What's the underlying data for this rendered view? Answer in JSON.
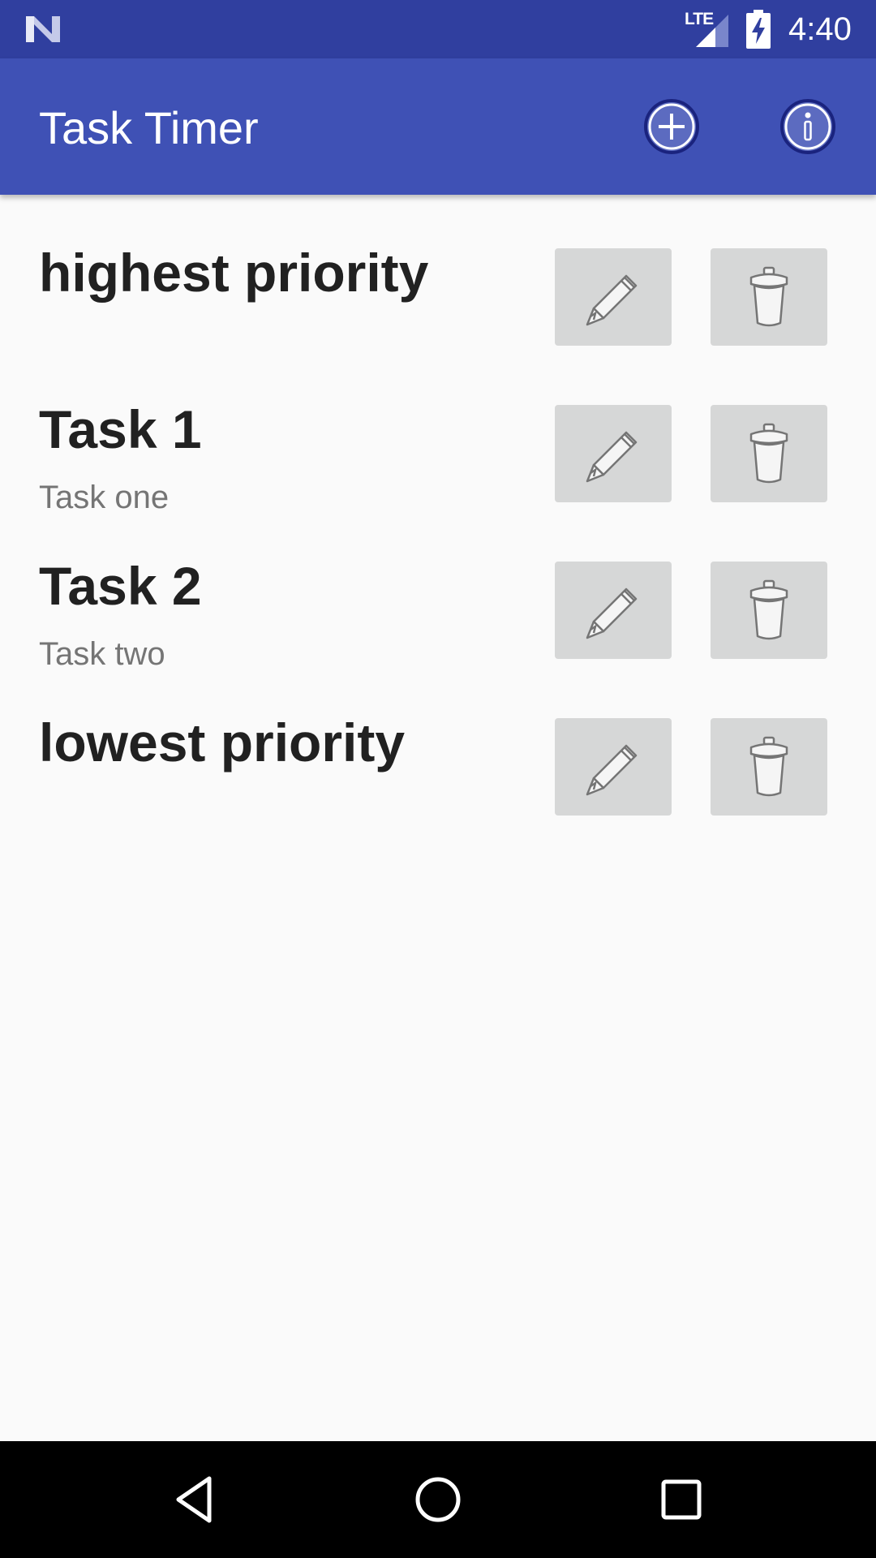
{
  "status_bar": {
    "network_label": "LTE",
    "time": "4:40",
    "icons": [
      "notification-n-icon",
      "signal-icon",
      "battery-charging-icon"
    ]
  },
  "app_bar": {
    "title": "Task Timer",
    "actions": [
      {
        "icon": "add-circle-icon"
      },
      {
        "icon": "info-circle-icon"
      }
    ],
    "background": "#3f51b5",
    "status_background": "#303f9f"
  },
  "tasks": [
    {
      "name": "highest priority",
      "description": ""
    },
    {
      "name": "Task 1",
      "description": "Task one"
    },
    {
      "name": "Task 2",
      "description": "Task two"
    },
    {
      "name": "lowest priority",
      "description": ""
    }
  ],
  "row_buttons": {
    "edit_icon": "pencil-icon",
    "delete_icon": "trash-icon",
    "button_color": "#d6d7d7"
  },
  "nav_bar": {
    "icons": [
      "back-icon",
      "home-icon",
      "recents-icon"
    ]
  }
}
